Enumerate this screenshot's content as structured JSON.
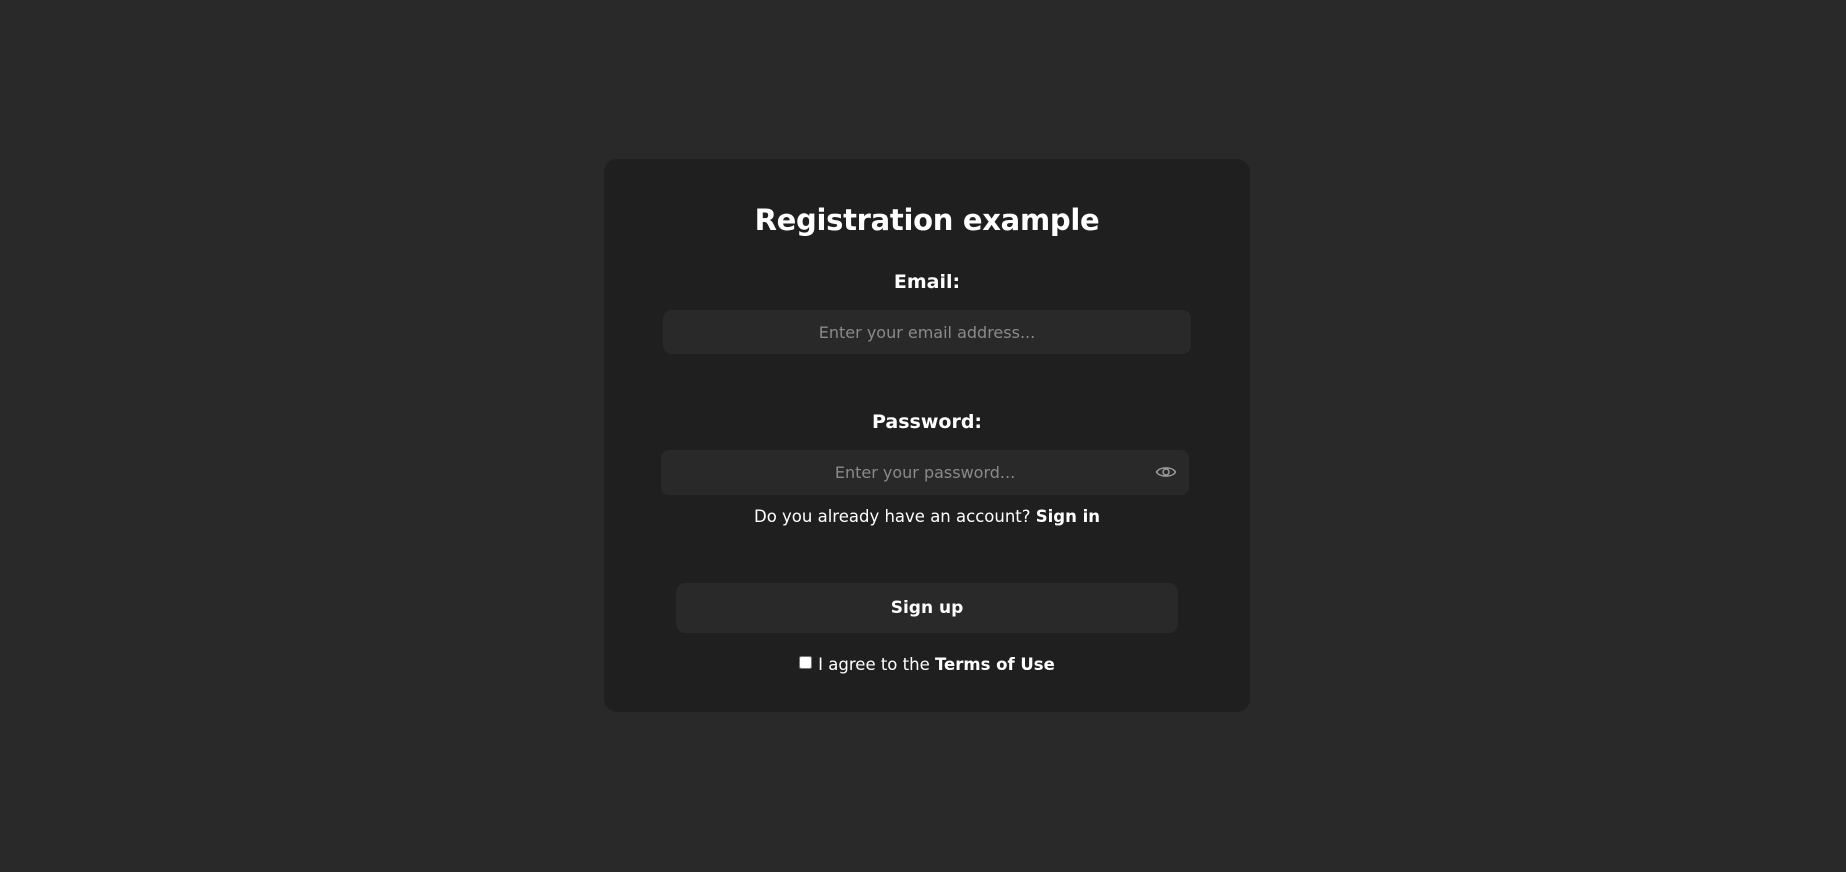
{
  "form": {
    "title": "Registration example",
    "email": {
      "label": "Email:",
      "placeholder": "Enter your email address..."
    },
    "password": {
      "label": "Password:",
      "placeholder": "Enter your password...",
      "toggle_icon": "eye-icon"
    },
    "signin_prompt": {
      "text": "Do you already have an account? ",
      "link_label": "Sign in"
    },
    "signup_button_label": "Sign up",
    "terms": {
      "text": "I agree to the ",
      "link_label": "Terms of Use",
      "checked": false
    }
  },
  "colors": {
    "page_background": "#292929",
    "card_background": "#1f1f1f",
    "input_background": "#292929",
    "text": "#ffffff",
    "placeholder": "#8a8a8a"
  }
}
